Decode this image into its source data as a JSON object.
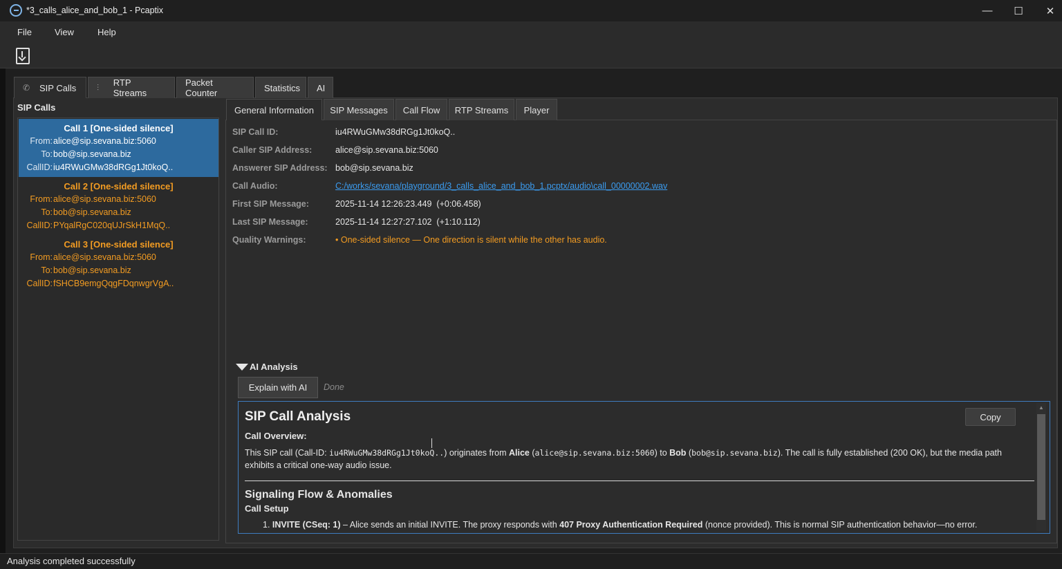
{
  "window": {
    "title": "*3_calls_alice_and_bob_1 - Pcaptix",
    "minimize": "—",
    "maximize": "☐",
    "close": "✕"
  },
  "menu": [
    "File",
    "View",
    "Help"
  ],
  "toolbar": {
    "export_icon": "file-download-icon"
  },
  "main_tabs": [
    {
      "label": "SIP Calls",
      "icon": "phone-icon"
    },
    {
      "label": "RTP Streams",
      "icon": "waveform-icon"
    },
    {
      "label": "Packet Counter"
    },
    {
      "label": "Statistics"
    },
    {
      "label": "AI"
    }
  ],
  "sip_calls": {
    "title": "SIP Calls",
    "from_key": "From:",
    "to_key": "To:",
    "callid_key": "CallID:",
    "items": [
      {
        "title": "Call 1 [One-sided silence]",
        "from": "alice@sip.sevana.biz:5060",
        "to": "bob@sip.sevana.biz",
        "callid": "iu4RWuGMw38dRGg1Jt0koQ.."
      },
      {
        "title": "Call 2 [One-sided silence]",
        "from": "alice@sip.sevana.biz:5060",
        "to": "bob@sip.sevana.biz",
        "callid": "PYqalRgC020qUJrSkH1MqQ.."
      },
      {
        "title": "Call 3 [One-sided silence]",
        "from": "alice@sip.sevana.biz:5060",
        "to": "bob@sip.sevana.biz",
        "callid": "fSHCB9emgQqgFDqnwgrVgA.."
      }
    ]
  },
  "sub_tabs": [
    "General Information",
    "SIP Messages",
    "Call Flow",
    "RTP Streams",
    "Player"
  ],
  "general_info": {
    "sip_call_id_label": "SIP Call ID:",
    "sip_call_id": "iu4RWuGMw38dRGg1Jt0koQ..",
    "caller_label": "Caller SIP Address:",
    "caller": "alice@sip.sevana.biz:5060",
    "answerer_label": "Answerer SIP Address:",
    "answerer": "bob@sip.sevana.biz",
    "audio_label": "Call Audio:",
    "audio": "C:/works/sevana/playground/3_calls_alice_and_bob_1.pcptx/audio\\call_00000002.wav",
    "first_label": "First SIP Message:",
    "first": "2025-11-14 12:26:23.449  (+0:06.458)",
    "last_label": "Last SIP Message:",
    "last": "2025-11-14 12:27:27.102  (+1:10.112)",
    "quality_label": "Quality Warnings:",
    "quality": "• One-sided silence — One direction is silent while the other has audio."
  },
  "ai": {
    "section_title": "AI Analysis",
    "explain_button": "Explain with AI",
    "status": "Done",
    "copy_button": "Copy",
    "heading": "SIP Call Analysis",
    "overview_heading": "Call Overview:",
    "overview": {
      "p1": "This SIP call (Call-ID: ",
      "callid": "iu4RWuGMw38dRGg1Jt0koQ..",
      "p2": ") originates from ",
      "alice": "Alice",
      "p3": " (",
      "alice_addr": "alice@sip.sevana.biz:5060",
      "p4": ") to ",
      "bob": "Bob",
      "p5": " (",
      "bob_addr": "bob@sip.sevana.biz",
      "p6": "). The call is fully established (200 OK), but the media path exhibits a critical one-way audio issue."
    },
    "signaling_heading": "Signaling Flow & Anomalies",
    "setup_heading": "Call Setup",
    "step1": {
      "num": "1. ",
      "b1": "INVITE (CSeq: 1)",
      "t1": " – Alice sends an initial INVITE. The proxy responds with ",
      "b2": "407 Proxy Authentication Required",
      "t2": " (nonce provided). This is normal SIP authentication behavior—no error."
    }
  },
  "status_bar": "Analysis completed successfully"
}
